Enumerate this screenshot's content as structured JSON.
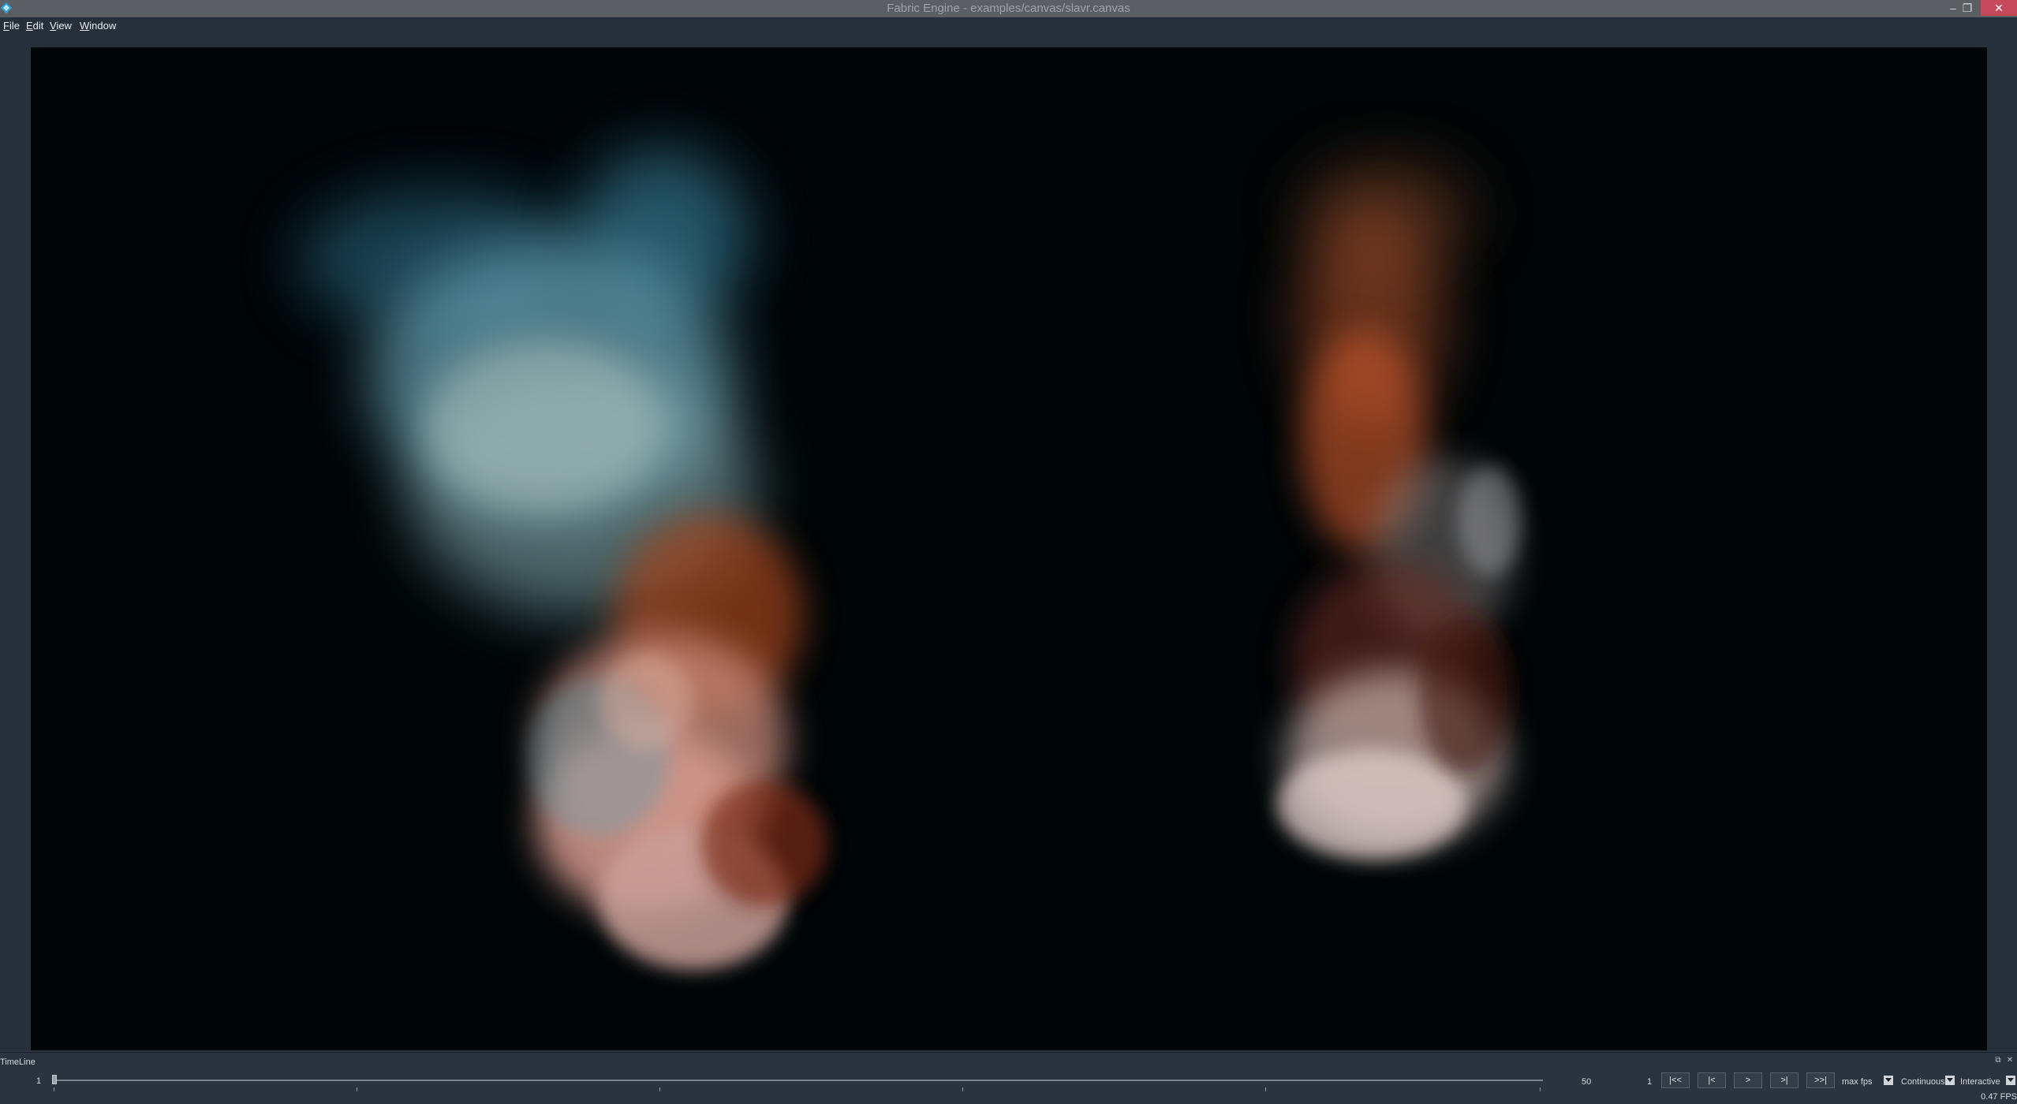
{
  "window": {
    "title": "Fabric Engine - examples/canvas/slavr.canvas",
    "minimize_glyph": "–",
    "restore_glyph": "❐",
    "close_glyph": "✕"
  },
  "menu": {
    "file": {
      "ul": "F",
      "rest": "ile"
    },
    "edit": {
      "ul": "E",
      "rest": "dit"
    },
    "view": {
      "ul": "V",
      "rest": "iew"
    },
    "window": {
      "ul": "W",
      "rest": "indow"
    }
  },
  "timeline": {
    "title": "TimeLine",
    "dock_float_glyph": "⧉",
    "dock_close_glyph": "✕",
    "start_frame": "1",
    "end_frame": "50",
    "current_frame": "1",
    "progress": 0.0,
    "buttons": {
      "go_start": "|<<",
      "step_back": "|<",
      "play": ">",
      "step_forward": ">|",
      "go_end": ">>|"
    },
    "rate_label": "max fps",
    "loop_mode": "Continuous",
    "sim_mode": "Interactive",
    "fps_readout": "0.47 FPS"
  },
  "colors": {
    "viewport_bg": "#000507",
    "smoke_blue": "#6aa6b8",
    "smoke_orange": "#c2552a",
    "smoke_pink": "#d69a8e",
    "close_button": "#c7495c"
  },
  "icons": [
    "app-logo-icon",
    "minimize-icon",
    "restore-icon",
    "close-icon",
    "dropdown-arrow-icon"
  ]
}
